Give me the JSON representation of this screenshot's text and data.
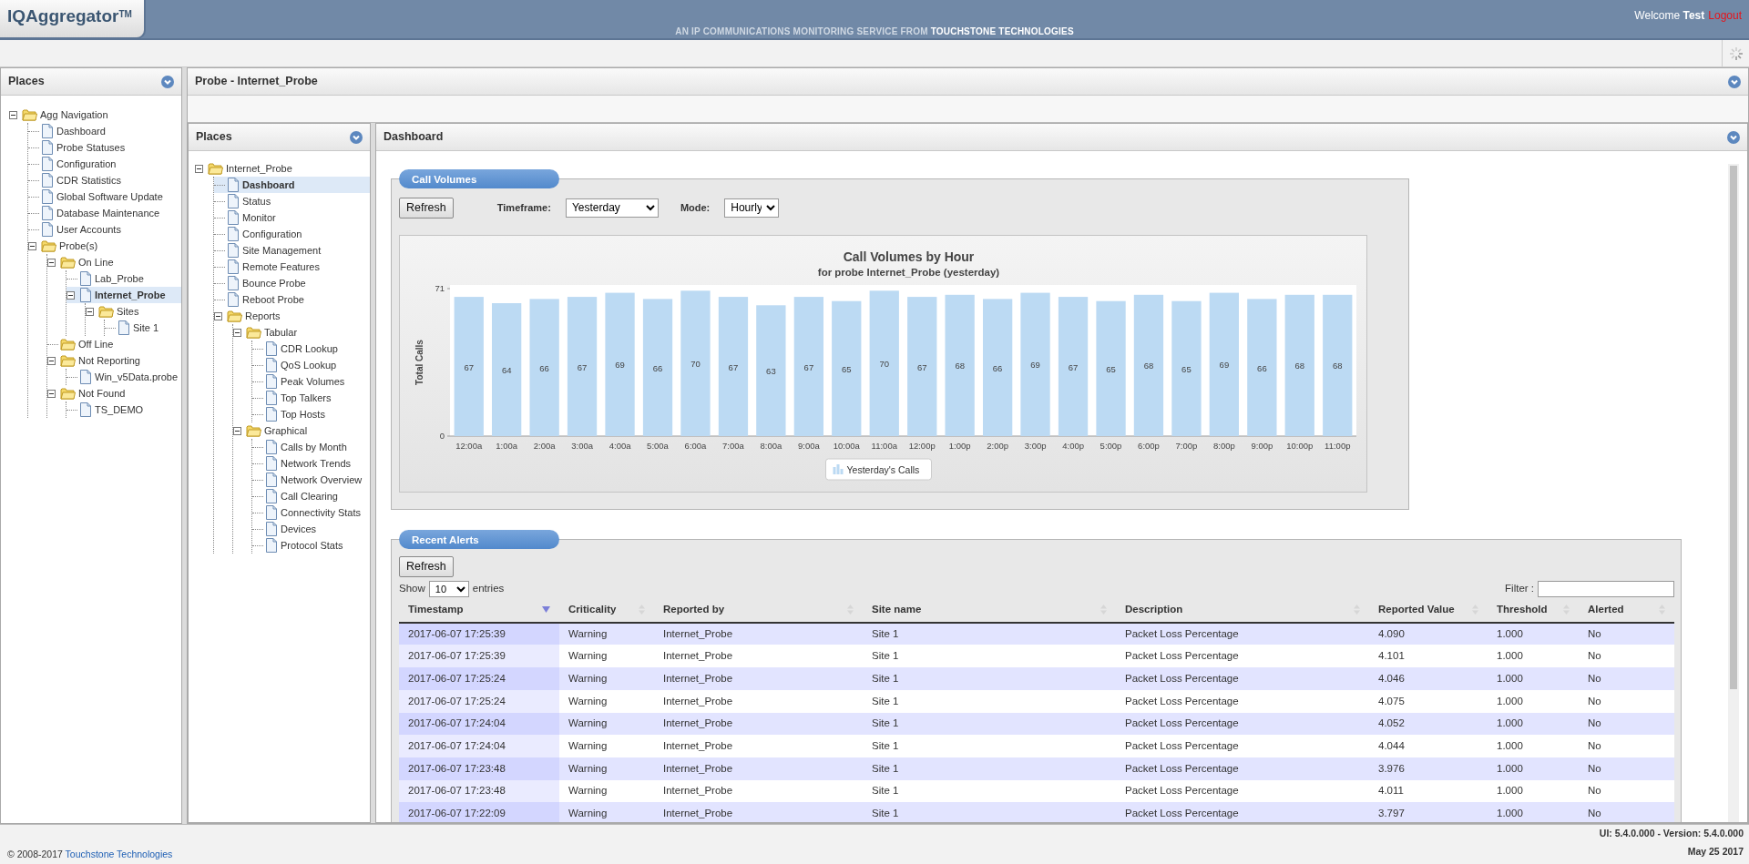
{
  "header": {
    "logo": "IQAggregator$^{TM}$",
    "tagline": "AN IP COMMUNICATIONS MONITORING SERVICE FROM **TOUCHSTONE TECHNOLOGIES**",
    "welcome": "Welcome **Test**",
    "logout": "Logout"
  },
  "left_panel": {
    "title": "Places",
    "tree": [
      {
        "label": "Agg Navigation",
        "kind": "folder",
        "expanded": true,
        "selected": false,
        "children": [
          {
            "label": "Dashboard",
            "kind": "page",
            "selected": false
          },
          {
            "label": "Probe Statuses",
            "kind": "page",
            "selected": false
          },
          {
            "label": "Configuration",
            "kind": "page",
            "selected": false
          },
          {
            "label": "CDR Statistics",
            "kind": "page",
            "selected": false
          },
          {
            "label": "Global Software Update",
            "kind": "page",
            "selected": false
          },
          {
            "label": "Database Maintenance",
            "kind": "page",
            "selected": false
          },
          {
            "label": "User Accounts",
            "kind": "page",
            "selected": false
          },
          {
            "label": "Probe(s)",
            "kind": "folder",
            "expanded": true,
            "selected": false,
            "children": [
              {
                "label": "On Line",
                "kind": "folder",
                "expanded": true,
                "selected": false,
                "children": [
                  {
                    "label": "Lab_Probe",
                    "kind": "page",
                    "selected": false
                  },
                  {
                    "label": "Internet_Probe",
                    "kind": "page",
                    "expanded": true,
                    "selected": true,
                    "children": [
                      {
                        "label": "Sites",
                        "kind": "folder",
                        "expanded": true,
                        "selected": false,
                        "children": [
                          {
                            "label": "Site 1",
                            "kind": "page",
                            "selected": false
                          }
                        ]
                      }
                    ]
                  }
                ]
              },
              {
                "label": "Off Line",
                "kind": "folder",
                "selected": false
              },
              {
                "label": "Not Reporting",
                "kind": "folder",
                "expanded": true,
                "selected": false,
                "children": [
                  {
                    "label": "Win_v5Data.probe",
                    "kind": "page",
                    "selected": false
                  }
                ]
              },
              {
                "label": "Not Found",
                "kind": "folder",
                "expanded": true,
                "selected": false,
                "children": [
                  {
                    "label": "TS_DEMO",
                    "kind": "page",
                    "selected": false
                  }
                ]
              }
            ]
          }
        ]
      }
    ]
  },
  "main_panel": {
    "title": "Probe - Internet_Probe"
  },
  "probe_panel": {
    "title": "Places",
    "tree": [
      {
        "label": "Internet_Probe",
        "kind": "folder",
        "expanded": true,
        "selected": false,
        "children": [
          {
            "label": "Dashboard",
            "kind": "page",
            "selected": true
          },
          {
            "label": "Status",
            "kind": "page",
            "selected": false
          },
          {
            "label": "Monitor",
            "kind": "page",
            "selected": false
          },
          {
            "label": "Configuration",
            "kind": "page",
            "selected": false
          },
          {
            "label": "Site Management",
            "kind": "page",
            "selected": false
          },
          {
            "label": "Remote Features",
            "kind": "page",
            "selected": false
          },
          {
            "label": "Bounce Probe",
            "kind": "page",
            "selected": false
          },
          {
            "label": "Reboot Probe",
            "kind": "page",
            "selected": false
          },
          {
            "label": "Reports",
            "kind": "folder",
            "expanded": true,
            "selected": false,
            "children": [
              {
                "label": "Tabular",
                "kind": "folder",
                "expanded": true,
                "selected": false,
                "children": [
                  {
                    "label": "CDR Lookup",
                    "kind": "page",
                    "selected": false
                  },
                  {
                    "label": "QoS Lookup",
                    "kind": "page",
                    "selected": false
                  },
                  {
                    "label": "Peak Volumes",
                    "kind": "page",
                    "selected": false
                  },
                  {
                    "label": "Top Talkers",
                    "kind": "page",
                    "selected": false
                  },
                  {
                    "label": "Top Hosts",
                    "kind": "page",
                    "selected": false
                  }
                ]
              },
              {
                "label": "Graphical",
                "kind": "folder",
                "expanded": true,
                "selected": false,
                "children": [
                  {
                    "label": "Calls by Month",
                    "kind": "page",
                    "selected": false
                  },
                  {
                    "label": "Network Trends",
                    "kind": "page",
                    "selected": false
                  },
                  {
                    "label": "Network Overview",
                    "kind": "page",
                    "selected": false
                  },
                  {
                    "label": "Call Clearing",
                    "kind": "page",
                    "selected": false
                  },
                  {
                    "label": "Connectivity Stats",
                    "kind": "page",
                    "selected": false
                  },
                  {
                    "label": "Devices",
                    "kind": "page",
                    "selected": false
                  },
                  {
                    "label": "Protocol Stats",
                    "kind": "page",
                    "selected": false
                  }
                ]
              }
            ]
          }
        ]
      }
    ]
  },
  "dashboard": {
    "title": "Dashboard",
    "call_volumes": {
      "title": "Call Volumes",
      "refresh": "Refresh",
      "timeframe_label": "Timeframe:",
      "timeframe": "Yesterday",
      "mode_label": "Mode:",
      "mode": "Hourly",
      "chart_subtitle": "for probe Internet_Probe (yesterday)",
      "chart_data": {
        "type": "bar",
        "title": "Call Volumes by Hour",
        "ylabel": "Total Calls",
        "categories": [
          "12:00a",
          "1:00a",
          "2:00a",
          "3:00a",
          "4:00a",
          "5:00a",
          "6:00a",
          "7:00a",
          "8:00a",
          "9:00a",
          "10:00a",
          "11:00a",
          "12:00p",
          "1:00p",
          "2:00p",
          "3:00p",
          "4:00p",
          "5:00p",
          "6:00p",
          "7:00p",
          "8:00p",
          "9:00p",
          "10:00p",
          "11:00p"
        ],
        "series": [
          {
            "name": "Yesterday's Calls",
            "color": "#bcdaf3",
            "values": [
              67,
              64,
              66,
              67,
              69,
              66,
              70,
              67,
              63,
              67,
              65,
              70,
              67,
              68,
              66,
              69,
              67,
              65,
              68,
              65,
              69,
              66,
              68,
              68
            ]
          }
        ],
        "ylim": [
          0,
          71
        ],
        "yticks": [
          0,
          71
        ],
        "data_labels": true
      }
    },
    "recent_alerts": {
      "title": "Recent Alerts",
      "refresh": "Refresh",
      "show_label": "Show",
      "page_size": "10",
      "entries_label": "entries",
      "filter_label": "Filter :",
      "columns": [
        {
          "label": "Timestamp",
          "sorted": true
        },
        {
          "label": "Criticality",
          "sorted": false
        },
        {
          "label": "Reported by",
          "sorted": false
        },
        {
          "label": "Site name",
          "sorted": false
        },
        {
          "label": "Description",
          "sorted": false
        },
        {
          "label": "Reported Value",
          "sorted": false
        },
        {
          "label": "Threshold",
          "sorted": false
        },
        {
          "label": "Alerted",
          "sorted": false
        }
      ],
      "rows": [
        [
          "2017-06-07 17:25:39",
          "Warning",
          "Internet_Probe",
          "Site 1",
          "Packet Loss Percentage",
          "4.090",
          "1.000",
          "No"
        ],
        [
          "2017-06-07 17:25:39",
          "Warning",
          "Internet_Probe",
          "Site 1",
          "Packet Loss Percentage",
          "4.101",
          "1.000",
          "No"
        ],
        [
          "2017-06-07 17:25:24",
          "Warning",
          "Internet_Probe",
          "Site 1",
          "Packet Loss Percentage",
          "4.046",
          "1.000",
          "No"
        ],
        [
          "2017-06-07 17:25:24",
          "Warning",
          "Internet_Probe",
          "Site 1",
          "Packet Loss Percentage",
          "4.075",
          "1.000",
          "No"
        ],
        [
          "2017-06-07 17:24:04",
          "Warning",
          "Internet_Probe",
          "Site 1",
          "Packet Loss Percentage",
          "4.052",
          "1.000",
          "No"
        ],
        [
          "2017-06-07 17:24:04",
          "Warning",
          "Internet_Probe",
          "Site 1",
          "Packet Loss Percentage",
          "4.044",
          "1.000",
          "No"
        ],
        [
          "2017-06-07 17:23:48",
          "Warning",
          "Internet_Probe",
          "Site 1",
          "Packet Loss Percentage",
          "3.976",
          "1.000",
          "No"
        ],
        [
          "2017-06-07 17:23:48",
          "Warning",
          "Internet_Probe",
          "Site 1",
          "Packet Loss Percentage",
          "4.011",
          "1.000",
          "No"
        ],
        [
          "2017-06-07 17:22:09",
          "Warning",
          "Internet_Probe",
          "Site 1",
          "Packet Loss Percentage",
          "3.797",
          "1.000",
          "No"
        ]
      ]
    }
  },
  "footer": {
    "copyright": "© 2008-2017 ",
    "company": "Touchstone Technologies",
    "version": "UI: 5.4.0.000 - Version: 5.4.0.000",
    "date": "May 25 2017"
  }
}
